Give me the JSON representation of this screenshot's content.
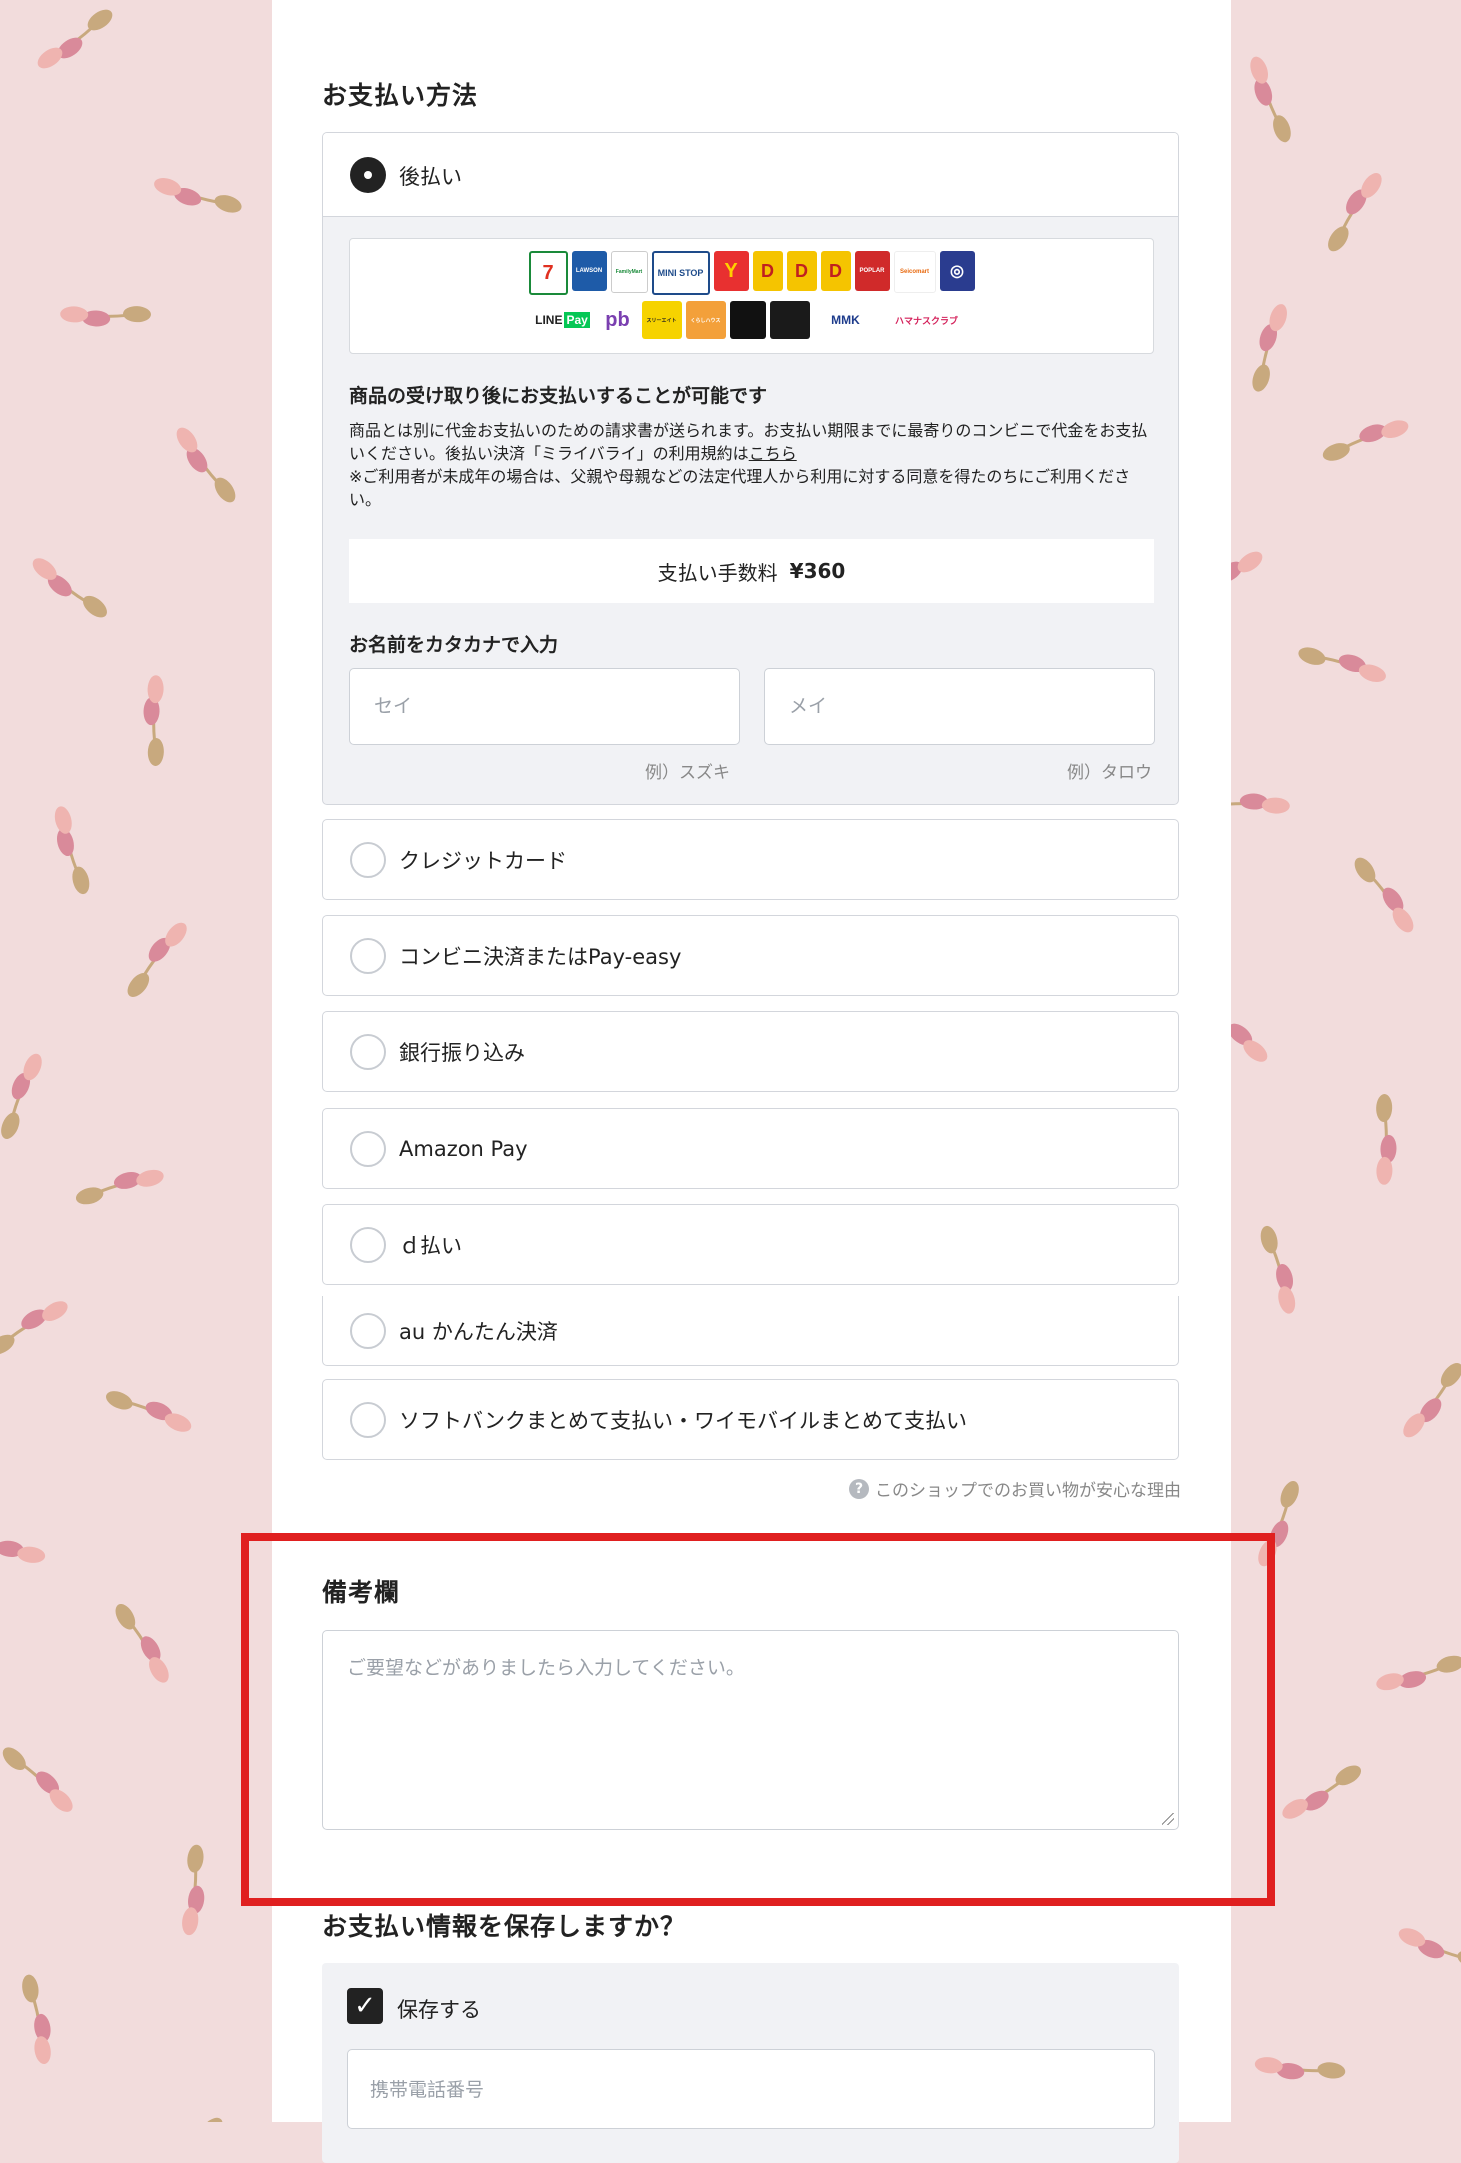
{
  "payment": {
    "title": "お支払い方法",
    "selected_label": "後払い",
    "afterpay": {
      "logos": {
        "row1": [
          "7-Eleven",
          "LAWSON",
          "FamilyMart",
          "MINI STOP",
          "Y",
          "D",
          "D",
          "D",
          "POPLAR",
          "Seicomart",
          "◎"
        ],
        "row2": [
          "LINE Pay",
          "pb",
          "スリーエイト",
          "くらしハウス",
          "",
          "",
          "MMK",
          "ハマナスクラブ"
        ]
      },
      "title": "商品の受け取り後にお支払いすることが可能です",
      "desc1": "商品とは別に代金お支払いのための請求書が送られます。お支払い期限までに最寄りのコンビニで代金をお支払いください。後払い決済「ミライバライ」の利用規約は",
      "desc_link": "こちら",
      "desc2": "※ご利用者が未成年の場合は、父親や母親などの法定代理人から利用に対する同意を得たのちにご利用ください。",
      "fee_label": "支払い手数料",
      "fee_amount": "¥360",
      "kana_title": "お名前をカタカナで入力",
      "sei_placeholder": "セイ",
      "mei_placeholder": "メイ",
      "sei_hint": "例）スズキ",
      "mei_hint": "例）タロウ"
    },
    "options": [
      {
        "label": "クレジットカード"
      },
      {
        "label": "コンビニ決済またはPay-easy"
      },
      {
        "label": "銀行振り込み"
      },
      {
        "label": "Amazon Pay"
      },
      {
        "label": "ｄ払い"
      },
      {
        "label": "au かんたん決済"
      },
      {
        "label": "ソフトバンクまとめて支払い・ワイモバイルまとめて支払い"
      }
    ],
    "reason_link": "このショップでのお買い物が安心な理由"
  },
  "notes": {
    "title": "備考欄",
    "placeholder": "ご要望などがありましたら入力してください。"
  },
  "save": {
    "title": "お支払い情報を保存しますか？",
    "checkbox_label": "保存する",
    "checked": true,
    "phone_placeholder": "携帯電話番号"
  },
  "colors": {
    "background": "#f2dcdc",
    "highlight": "#e02020",
    "leaf_tan": "#c8a97e",
    "leaf_pink": "#d98a9a",
    "leaf_light": "#efb4b0"
  }
}
